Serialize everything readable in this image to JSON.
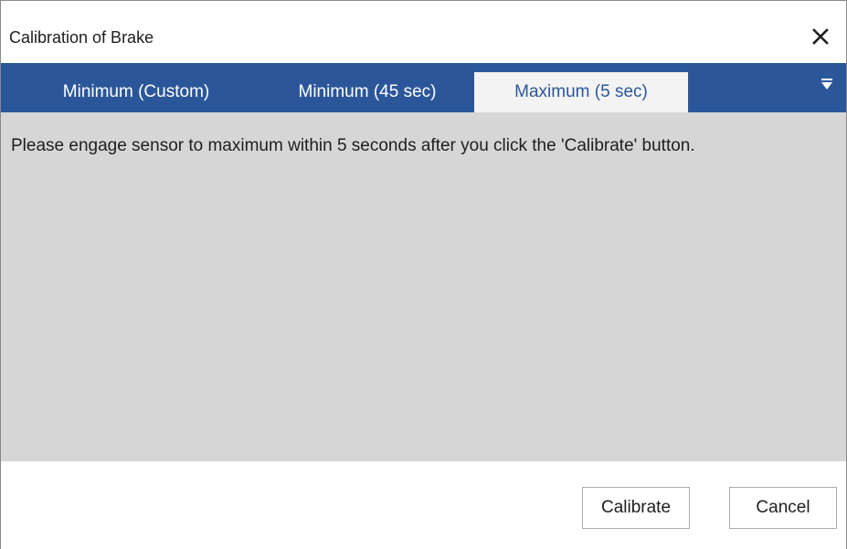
{
  "window": {
    "title": "Calibration of Brake",
    "close_icon": "close-icon"
  },
  "tabs": [
    {
      "label": "Minimum (Custom)",
      "active": false
    },
    {
      "label": "Minimum (45 sec)",
      "active": false
    },
    {
      "label": "Maximum (5 sec)",
      "active": true
    }
  ],
  "tabs_overflow_icon": "dropdown-triangle-icon",
  "content": {
    "message": "Please engage sensor to maximum within 5 seconds after you click the 'Calibrate' button."
  },
  "footer": {
    "calibrate_label": "Calibrate",
    "cancel_label": "Cancel"
  },
  "colors": {
    "tab_strip": "#2b579a",
    "active_tab_bg": "#f3f3f3",
    "content_bg": "#d6d6d6"
  }
}
